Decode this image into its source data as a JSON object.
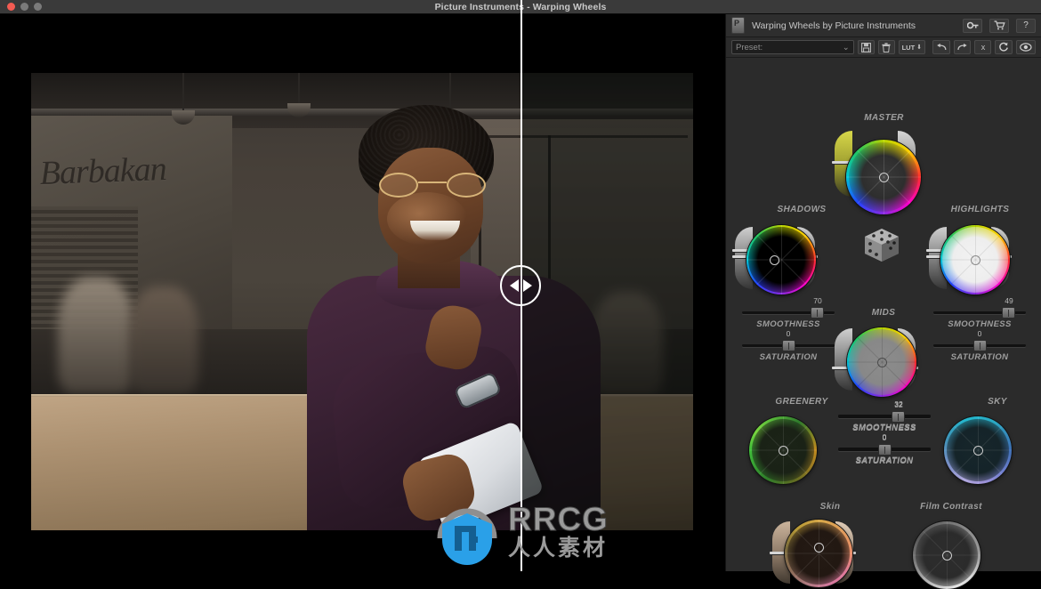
{
  "window": {
    "title": "Picture Instruments - Warping Wheels",
    "traffic_lights": [
      "close",
      "minimize",
      "zoom"
    ]
  },
  "canvas": {
    "split_handle": "before-after-split",
    "watermark": {
      "brand": "RRCG",
      "subtitle": "人人素材"
    }
  },
  "panel": {
    "header": {
      "logo": "P",
      "title": "Warping Wheels by Picture Instruments",
      "buttons": [
        {
          "name": "license-key-button",
          "icon": "key-icon",
          "glyph": "⚷"
        },
        {
          "name": "cart-button",
          "icon": "cart-icon",
          "glyph": "🛒"
        },
        {
          "name": "help-button",
          "icon": "question-icon",
          "glyph": "?"
        }
      ]
    },
    "toolbar": {
      "preset_label": "Preset:",
      "preset_value": "",
      "dropdown_glyph": "⌄",
      "save_preset": "save-icon",
      "delete_preset": "trash-icon",
      "lut_label": "LUT",
      "lut_glyph": "⬇",
      "undo_glyph": "↰",
      "redo_glyph": "↱",
      "clear_glyph": "x",
      "reset_glyph": "↻",
      "compare_glyph": "◑"
    },
    "randomize": {
      "name": "dice-randomize-button",
      "icon": "dice-icon"
    },
    "wheels": [
      {
        "id": "master",
        "label": "MASTER",
        "has_arcs": true,
        "center": "dark-rainbow"
      },
      {
        "id": "shadows",
        "label": "SHADOWS",
        "has_arcs": true,
        "center": "black"
      },
      {
        "id": "highlights",
        "label": "HIGHLIGHTS",
        "has_arcs": true,
        "center": "white"
      },
      {
        "id": "mids",
        "label": "MIDS",
        "has_arcs": true,
        "center": "gray"
      },
      {
        "id": "greenery",
        "label": "GREENERY",
        "has_arcs": false,
        "center": "dark-green"
      },
      {
        "id": "sky",
        "label": "SKY",
        "has_arcs": false,
        "center": "dark-teal"
      },
      {
        "id": "skin",
        "label": "Skin",
        "has_arcs": true,
        "center": "dark-brown"
      },
      {
        "id": "film_contrast",
        "label": "Film Contrast",
        "has_arcs": false,
        "center": "dark-gray"
      }
    ],
    "slider_groups": [
      {
        "id": "shadows",
        "smoothness": {
          "label": "SMOOTHNESS",
          "value": "70",
          "percent": 70
        },
        "saturation": {
          "label": "SATURATION",
          "value": "0",
          "percent": 50
        }
      },
      {
        "id": "highlights",
        "smoothness": {
          "label": "SMOOTHNESS",
          "value": "49",
          "percent": 72
        },
        "saturation": {
          "label": "SATURATION",
          "value": "0",
          "percent": 50
        }
      },
      {
        "id": "mids",
        "smoothness": {
          "label": "SMOOTHNESS",
          "value": "32",
          "percent": 58
        },
        "saturation": {
          "label": "SATURATION",
          "value": "0",
          "percent": 50
        }
      },
      {
        "id": "greenery_sky",
        "smoothness": {
          "label": "SMOOTHNESS",
          "value": "32",
          "percent": 58
        },
        "saturation": {
          "label": "SATURATION",
          "value": "0",
          "percent": 50
        }
      }
    ],
    "colors": {
      "panel_bg": "#2b2b2b",
      "header_bg": "#2e2e2e",
      "label_text": "#9e9e9e",
      "title_text": "#c6c6c6"
    }
  }
}
